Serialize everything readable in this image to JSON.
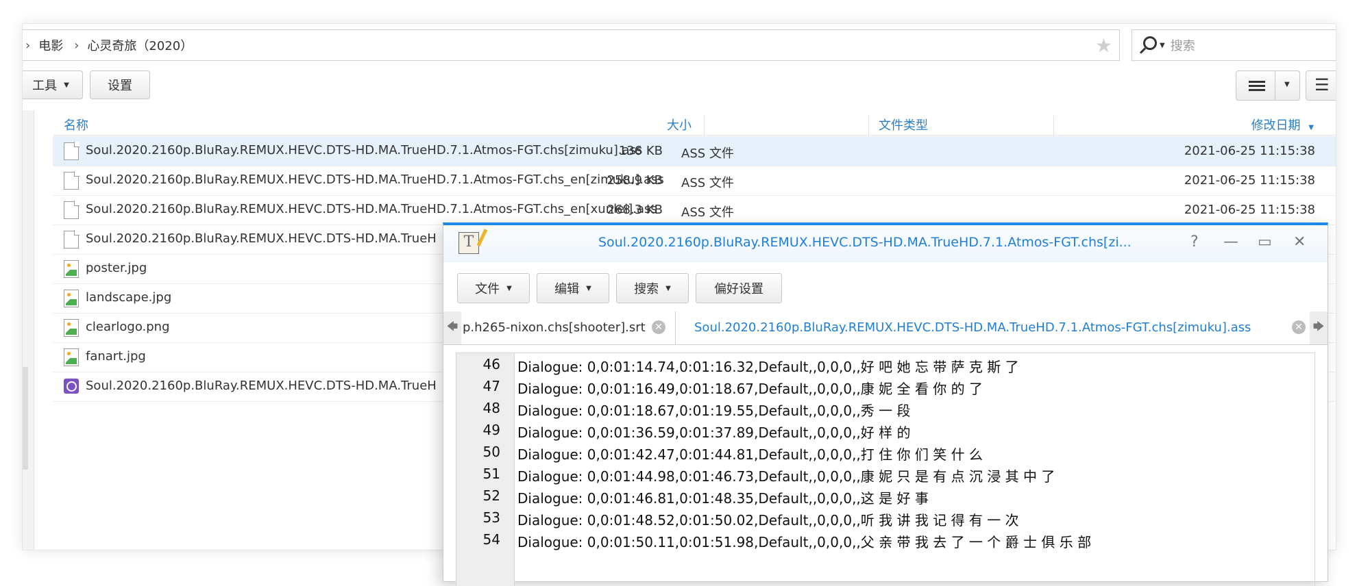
{
  "breadcrumb": {
    "items": [
      "电影",
      "心灵奇旅（2020）"
    ]
  },
  "search": {
    "placeholder": "搜索"
  },
  "toolbar": {
    "tools_label": "工具",
    "settings_label": "设置"
  },
  "columns": {
    "name": "名称",
    "size": "大小",
    "type": "文件类型",
    "date": "修改日期"
  },
  "files": [
    {
      "name": "Soul.2020.2160p.BluRay.REMUX.HEVC.DTS-HD.MA.TrueHD.7.1.Atmos-FGT.chs[zimuku].ass",
      "size": "136 KB",
      "type": "ASS 文件",
      "date": "2021-06-25 11:15:38",
      "icon": "document-icon"
    },
    {
      "name": "Soul.2020.2160p.BluRay.REMUX.HEVC.DTS-HD.MA.TrueHD.7.1.Atmos-FGT.chs_en[zimuku].ass",
      "size": "258.9 KB",
      "type": "ASS 文件",
      "date": "2021-06-25 11:15:38",
      "icon": "document-icon"
    },
    {
      "name": "Soul.2020.2160p.BluRay.REMUX.HEVC.DTS-HD.MA.TrueHD.7.1.Atmos-FGT.chs_en[xunlei].ass",
      "size": "268.3 KB",
      "type": "ASS 文件",
      "date": "2021-06-25 11:15:38",
      "icon": "document-icon"
    },
    {
      "name": "Soul.2020.2160p.BluRay.REMUX.HEVC.DTS-HD.MA.TrueH",
      "size": "",
      "type": "",
      "date": "",
      "icon": "document-icon"
    },
    {
      "name": "poster.jpg",
      "size": "",
      "type": "",
      "date": "",
      "icon": "image-icon"
    },
    {
      "name": "landscape.jpg",
      "size": "",
      "type": "",
      "date": "",
      "icon": "image-icon"
    },
    {
      "name": "clearlogo.png",
      "size": "",
      "type": "",
      "date": "",
      "icon": "image-icon"
    },
    {
      "name": "fanart.jpg",
      "size": "",
      "type": "",
      "date": "",
      "icon": "image-icon"
    },
    {
      "name": "Soul.2020.2160p.BluRay.REMUX.HEVC.DTS-HD.MA.TrueH",
      "size": "",
      "type": "",
      "date": "",
      "icon": "video-icon"
    }
  ],
  "editor_window": {
    "title": "Soul.2020.2160p.BluRay.REMUX.HEVC.DTS-HD.MA.TrueHD.7.1.Atmos-FGT.chs[zi...",
    "icon_letter": "T",
    "controls": {
      "help": "?",
      "minimize": "—",
      "maximize": "▭",
      "close": "✕"
    },
    "menu": {
      "file": "文件",
      "edit": "编辑",
      "search": "搜索",
      "prefs": "偏好设置"
    },
    "tabs": [
      {
        "label": "p.h265-nixon.chs[shooter].srt",
        "active": false
      },
      {
        "label": "Soul.2020.2160p.BluRay.REMUX.HEVC.DTS-HD.MA.TrueHD.7.1.Atmos-FGT.chs[zimuku].ass",
        "active": true
      }
    ],
    "lines": [
      {
        "n": "46",
        "text": "Dialogue: 0,0:01:14.74,0:01:16.32,Default,,0,0,0,,好 吧  她 忘 带 萨 克 斯 了"
      },
      {
        "n": "47",
        "text": "Dialogue: 0,0:01:16.49,0:01:18.67,Default,,0,0,0,,康 妮  全 看 你 的 了"
      },
      {
        "n": "48",
        "text": "Dialogue: 0,0:01:18.67,0:01:19.55,Default,,0,0,0,,秀 一 段"
      },
      {
        "n": "49",
        "text": "Dialogue: 0,0:01:36.59,0:01:37.89,Default,,0,0,0,,好 样 的"
      },
      {
        "n": "50",
        "text": "Dialogue: 0,0:01:42.47,0:01:44.81,Default,,0,0,0,,打 住  你 们 笑 什 么"
      },
      {
        "n": "51",
        "text": "Dialogue: 0,0:01:44.98,0:01:46.73,Default,,0,0,0,,康 妮 只 是 有 点 沉 浸 其 中 了"
      },
      {
        "n": "52",
        "text": "Dialogue: 0,0:01:46.81,0:01:48.35,Default,,0,0,0,,这 是 好 事"
      },
      {
        "n": "53",
        "text": "Dialogue: 0,0:01:48.52,0:01:50.02,Default,,0,0,0,,听 我 讲  我 记 得 有 一 次"
      },
      {
        "n": "54",
        "text": "Dialogue: 0,0:01:50.11,0:01:51.98,Default,,0,0,0,,父 亲 带 我 去 了 一 个 爵 士 俱 乐 部"
      }
    ]
  },
  "colors": {
    "accent": "#1f7fd6",
    "selected_row": "#e6f1fb"
  }
}
